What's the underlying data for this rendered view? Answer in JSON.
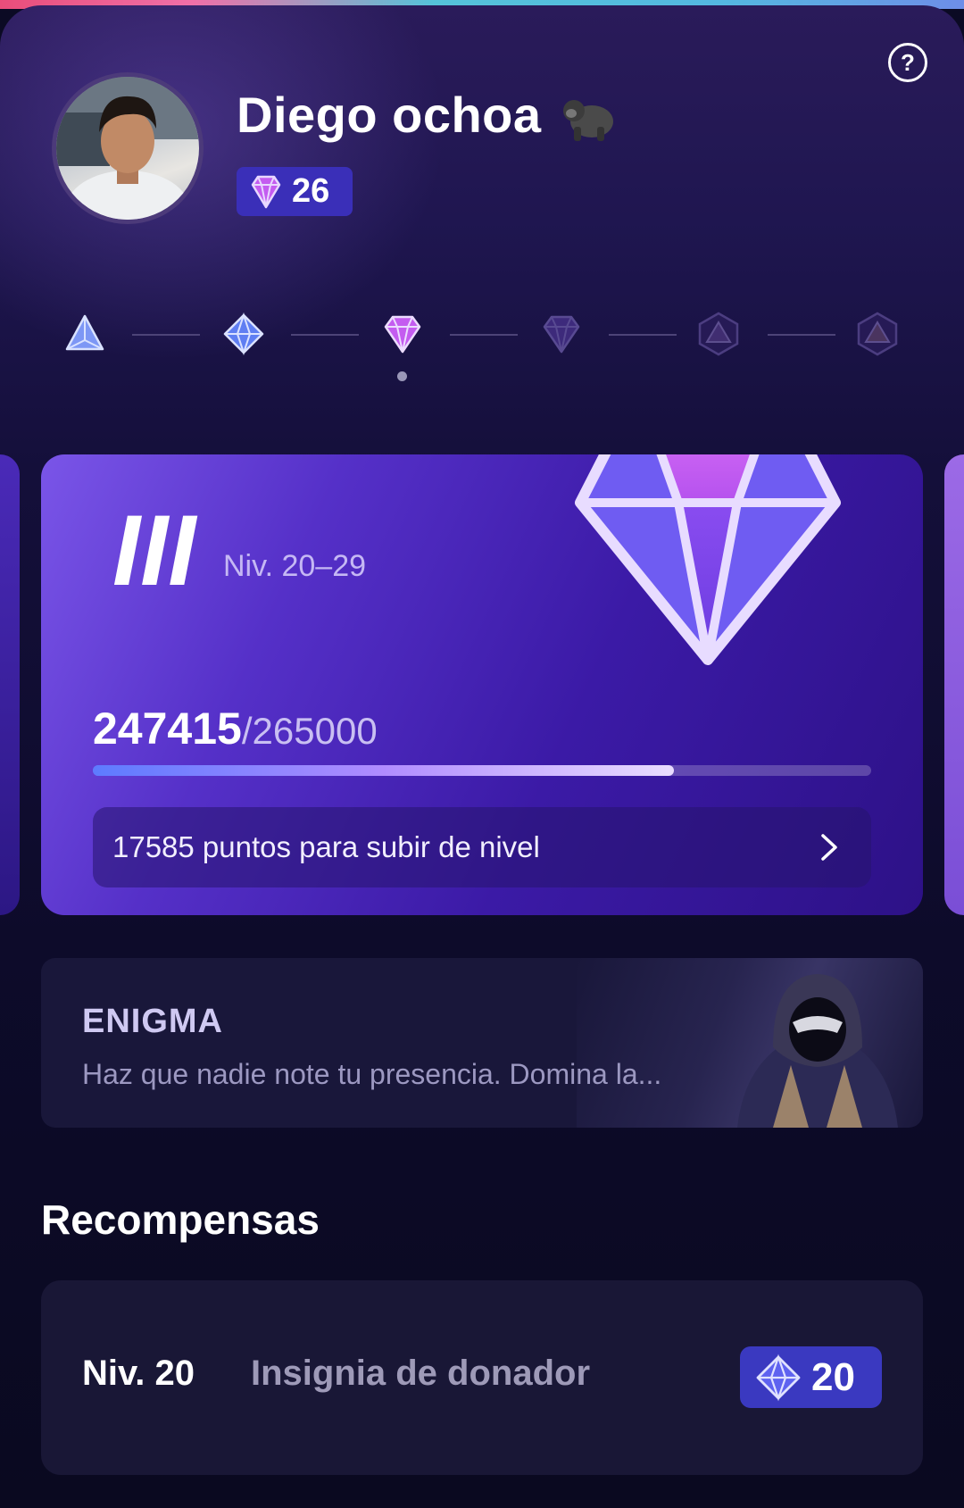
{
  "profile": {
    "name": "Diego ochoa",
    "level": "26"
  },
  "tiers": [
    "tier-1",
    "tier-2",
    "tier-3",
    "tier-4",
    "tier-5",
    "tier-6"
  ],
  "level_card": {
    "roman": "III",
    "range": "Niv. 20–29",
    "current_points": "247415",
    "total_points": "/265000",
    "progress_fraction": 0.7468,
    "cta_text": "17585 puntos para subir de nivel"
  },
  "enigma": {
    "title": "ENIGMA",
    "description": "Haz que nadie note tu presencia. Domina la..."
  },
  "rewards": {
    "title": "Recompensas",
    "items": [
      {
        "level": "Niv. 20",
        "name": "Insignia de donador",
        "badge": "20"
      }
    ]
  },
  "colors": {
    "accent": "#3a39c0",
    "card": "#5530c8"
  }
}
